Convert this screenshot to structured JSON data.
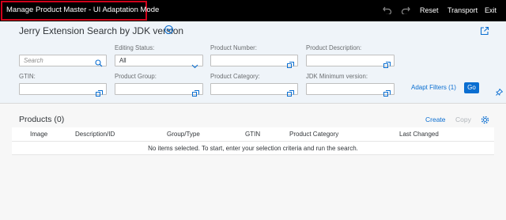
{
  "shell": {
    "app_title": "Manage Product Master  - UI Adaptation Mode",
    "undo_icon": "undo-icon",
    "redo_icon": "redo-icon",
    "reset_label": "Reset",
    "transport_label": "Transport",
    "exit_label": "Exit",
    "highlight_color": "#d0021b"
  },
  "filter_bar": {
    "variant_title": "Jerry Extension Search by JDK version",
    "search": {
      "placeholder": "Search"
    },
    "editing_status": {
      "label": "Editing Status:",
      "value": "All"
    },
    "product_number": {
      "label": "Product Number:",
      "value": ""
    },
    "product_description": {
      "label": "Product Description:",
      "value": ""
    },
    "gtin": {
      "label": "GTIN:",
      "value": ""
    },
    "product_group": {
      "label": "Product Group:",
      "value": ""
    },
    "product_category": {
      "label": "Product Category:",
      "value": ""
    },
    "jdk_minimum_version": {
      "label": "JDK Minimum version:",
      "value": ""
    },
    "adapt_filters_label": "Adapt Filters (1)",
    "go_label": "Go"
  },
  "table": {
    "title": "Products (0)",
    "create_label": "Create",
    "copy_label": "Copy",
    "columns": [
      "Image",
      "Description/ID",
      "Group/Type",
      "GTIN",
      "Product Category",
      "Last Changed"
    ],
    "empty_message": "No items selected. To start, enter your selection criteria and run the search."
  },
  "colors": {
    "accent": "#0a6ed1",
    "header_bg": "#eff4f9",
    "shell_bg": "#000000"
  }
}
